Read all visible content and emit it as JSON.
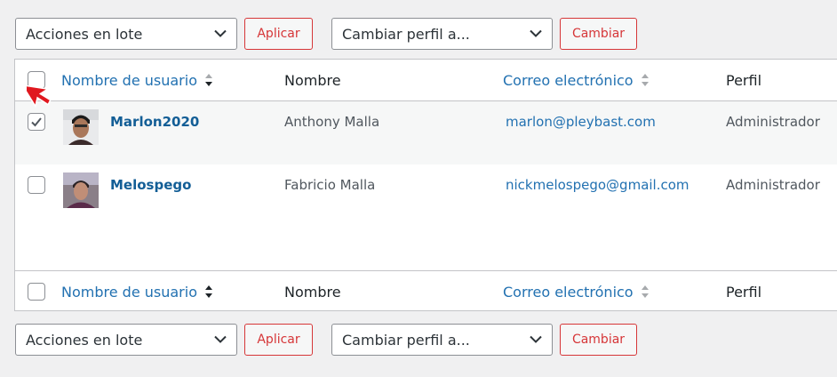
{
  "bulk_actions": {
    "select_value": "Acciones en lote",
    "apply_label": "Aplicar",
    "role_select_value": "Cambiar perfil a...",
    "change_label": "Cambiar"
  },
  "columns": {
    "username": "Nombre de usuario",
    "name": "Nombre",
    "email": "Correo electrónico",
    "role": "Perfil"
  },
  "users": [
    {
      "username": "Marlon2020",
      "name": "Anthony Malla",
      "email": "marlon@pleybast.com",
      "role": "Administrador",
      "checked": true
    },
    {
      "username": "Melospego",
      "name": "Fabricio Malla",
      "email": "nickmelospego@gmail.com",
      "role": "Administrador",
      "checked": false
    }
  ],
  "colors": {
    "link": "#2271b1",
    "username_link": "#135e96",
    "danger": "#d63638",
    "cursor": "#e0181f"
  }
}
